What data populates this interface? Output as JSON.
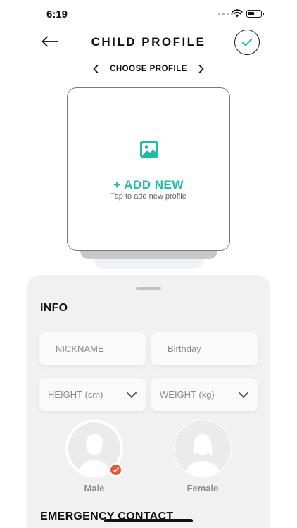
{
  "status_bar": {
    "time": "6:19"
  },
  "header": {
    "title": "CHILD PROFILE"
  },
  "profile_switcher": {
    "label": "CHOOSE PROFILE"
  },
  "profile_card": {
    "add_label": "+ ADD NEW",
    "hint": "Tap to add new profile"
  },
  "info": {
    "title": "INFO",
    "nickname_placeholder": "NICKNAME",
    "birthday_placeholder": "Birthday",
    "height_label": "HEIGHT (cm)",
    "weight_label": "WEIGHT (kg)",
    "gender_options": [
      {
        "label": "Male",
        "selected": true
      },
      {
        "label": "Female",
        "selected": false
      }
    ]
  },
  "emergency": {
    "title": "EMERGENCY CONTACT"
  },
  "colors": {
    "accent": "#22b9a7",
    "badge": "#e8573a",
    "sheet_bg": "#f1f1f1"
  },
  "icons": [
    "back-arrow-icon",
    "check-icon",
    "chevron-left-icon",
    "chevron-right-icon",
    "image-icon",
    "chevron-down-icon",
    "male-avatar-icon",
    "female-avatar-icon"
  ]
}
